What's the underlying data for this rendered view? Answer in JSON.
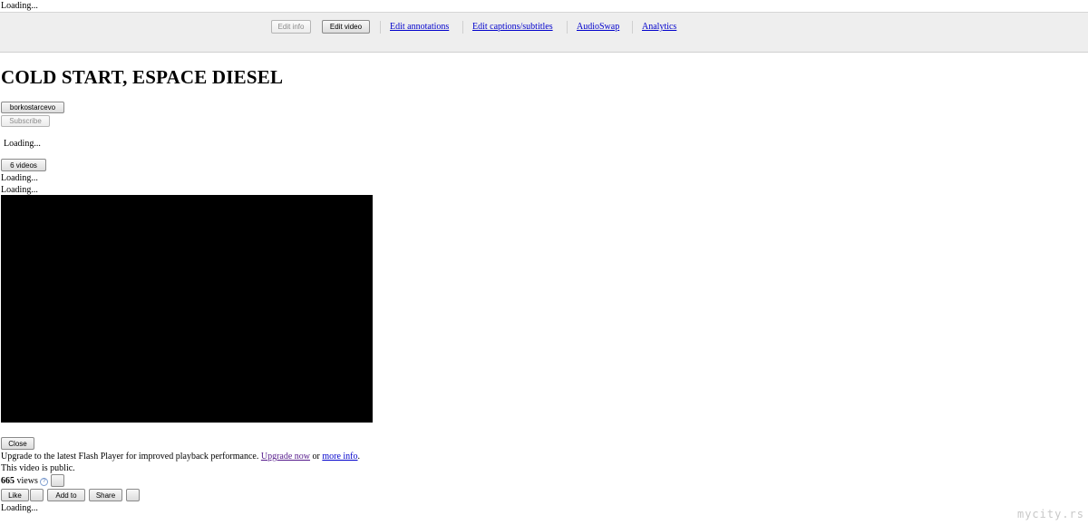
{
  "loading_text": "Loading...",
  "toolbar": {
    "edit_info": "Edit info",
    "edit_video": "Edit video",
    "links": [
      "Edit annotations",
      "Edit captions/subtitles",
      "AudioSwap",
      "Analytics"
    ]
  },
  "video": {
    "title": "COLD START, ESPACE DIESEL",
    "channel_button": "borkostarcevo",
    "subscribe_button": "Subscribe",
    "videos_button": "6 videos",
    "close_button": "Close",
    "flash_notice": {
      "text": "Upgrade to the latest Flash Player for improved playback performance.",
      "upgrade_link": "Upgrade now",
      "or_text": "or",
      "more_link": "more info",
      "period": "."
    },
    "public_notice": "This video is public.",
    "views_count": "665",
    "views_label": "views",
    "help_icon_glyph": "?",
    "actions": {
      "like": "Like",
      "add_to": "Add to",
      "share": "Share"
    }
  },
  "watermark": "mycity.rs"
}
